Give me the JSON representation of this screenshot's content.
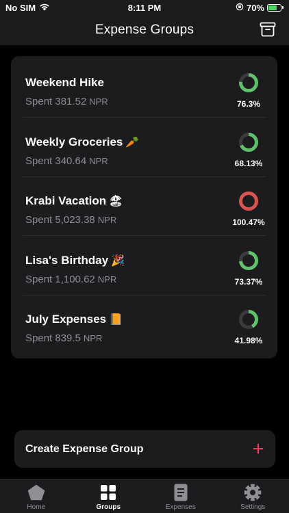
{
  "status_bar": {
    "carrier": "No SIM",
    "time": "8:11 PM",
    "battery_percent": "70%",
    "battery_level": 0.7
  },
  "header": {
    "title": "Expense Groups",
    "archive_icon": "archive-box-icon"
  },
  "groups": [
    {
      "name": "Weekend Hike",
      "emoji": "",
      "spent": "Spent 381.52",
      "currency": "NPR",
      "percent_label": "76.3%",
      "percent": 76.3,
      "ring_color": "#5dc26a"
    },
    {
      "name": "Weekly Groceries",
      "emoji": "🥕",
      "spent": "Spent 340.64",
      "currency": "NPR",
      "percent_label": "68.13%",
      "percent": 68.13,
      "ring_color": "#5dc26a"
    },
    {
      "name": "Krabi Vacation",
      "emoji": "🏖",
      "spent": "Spent 5,023.38",
      "currency": "NPR",
      "percent_label": "100.47%",
      "percent": 100.47,
      "ring_color": "#d9534f"
    },
    {
      "name": "Lisa's Birthday",
      "emoji": "🎉",
      "spent": "Spent 1,100.62",
      "currency": "NPR",
      "percent_label": "73.37%",
      "percent": 73.37,
      "ring_color": "#5dc26a"
    },
    {
      "name": "July Expenses",
      "emoji": "📙",
      "spent": "Spent 839.5",
      "currency": "NPR",
      "percent_label": "41.98%",
      "percent": 41.98,
      "ring_color": "#5dc26a"
    }
  ],
  "create_button": {
    "label": "Create Expense Group",
    "icon": "plus-icon",
    "icon_color": "#ff375f"
  },
  "tabs": [
    {
      "label": "Home",
      "icon": "pentagon-home-icon",
      "active": false
    },
    {
      "label": "Groups",
      "icon": "grid-groups-icon",
      "active": true
    },
    {
      "label": "Expenses",
      "icon": "document-expenses-icon",
      "active": false
    },
    {
      "label": "Settings",
      "icon": "gear-icon",
      "active": false
    }
  ],
  "colors": {
    "background": "#000000",
    "surface": "#1c1c1e",
    "ring_track": "#3a3a3c",
    "secondary_text": "#8e8e93"
  }
}
